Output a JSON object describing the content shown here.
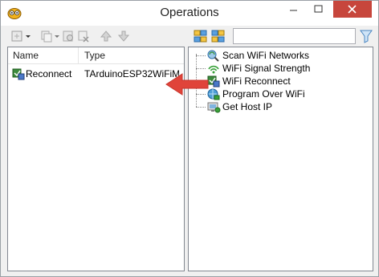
{
  "window": {
    "title": "Operations"
  },
  "toolbar": {
    "search": {
      "value": "",
      "placeholder": ""
    },
    "icons": [
      "add-icon",
      "dropdown-icon",
      "copy-icon",
      "paste-icon",
      "delete-icon",
      "move-up-icon",
      "move-down-icon",
      "expand-all-icon",
      "collapse-all-icon",
      "filter-icon"
    ]
  },
  "list": {
    "columns": [
      "Name",
      "Type"
    ],
    "rows": [
      {
        "name": "Reconnect",
        "type": "TArduinoESP32WiFiM...",
        "icon": "wifi-reconnect-icon"
      }
    ]
  },
  "tree": {
    "items": [
      {
        "label": "Scan WiFi Networks",
        "icon": "scan-wifi-icon"
      },
      {
        "label": "WiFi Signal Strength",
        "icon": "signal-strength-icon"
      },
      {
        "label": "WiFi Reconnect",
        "icon": "wifi-reconnect-icon"
      },
      {
        "label": "Program Over WiFi",
        "icon": "program-over-wifi-icon"
      },
      {
        "label": "Get Host IP",
        "icon": "host-ip-icon"
      }
    ]
  },
  "colors": {
    "accent_arrow": "#e0443a",
    "close_button": "#c7463c"
  }
}
